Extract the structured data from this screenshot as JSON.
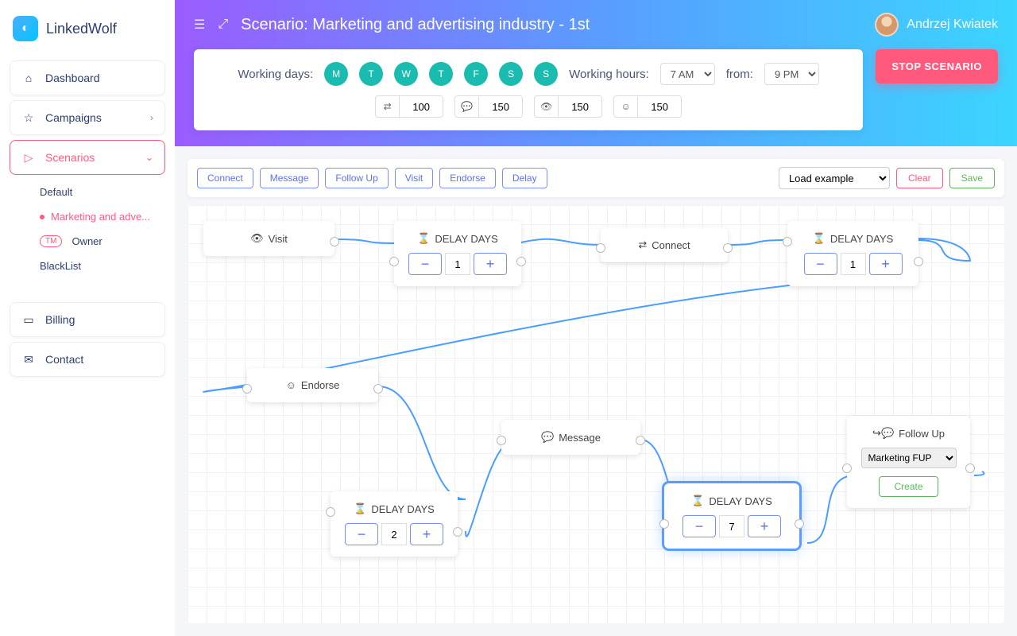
{
  "app_name": "LinkedWolf",
  "user_name": "Andrzej Kwiatek",
  "nav": {
    "dashboard": "Dashboard",
    "campaigns": "Campaigns",
    "scenarios": "Scenarios",
    "billing": "Billing",
    "contact": "Contact"
  },
  "subnav": {
    "default": "Default",
    "marketing": "Marketing and adve...",
    "owner": "Owner",
    "owner_badge": "TM",
    "blacklist": "BlackList"
  },
  "header": {
    "title": "Scenario: Marketing and advertising industry - 1st",
    "stop_label": "STOP SCENARIO"
  },
  "config": {
    "working_days_label": "Working days:",
    "days": [
      "M",
      "T",
      "W",
      "T",
      "F",
      "S",
      "S"
    ],
    "working_hours_label": "Working hours:",
    "hours_from": "7 AM",
    "from_label": "from:",
    "hours_to": "9 PM",
    "limit1": "100",
    "limit2": "150",
    "limit3": "150",
    "limit4": "150"
  },
  "toolbar": {
    "connect": "Connect",
    "message": "Message",
    "followup": "Follow Up",
    "visit": "Visit",
    "endorse": "Endorse",
    "delay": "Delay",
    "load_example": "Load example",
    "clear": "Clear",
    "save": "Save"
  },
  "nodes": {
    "visit": "Visit",
    "delay_label": "DELAY DAYS",
    "connect": "Connect",
    "endorse": "Endorse",
    "message": "Message",
    "followup": "Follow Up",
    "fup_option": "Marketing FUP",
    "create": "Create",
    "d1": "1",
    "d2": "1",
    "d3": "2",
    "d4": "7"
  }
}
